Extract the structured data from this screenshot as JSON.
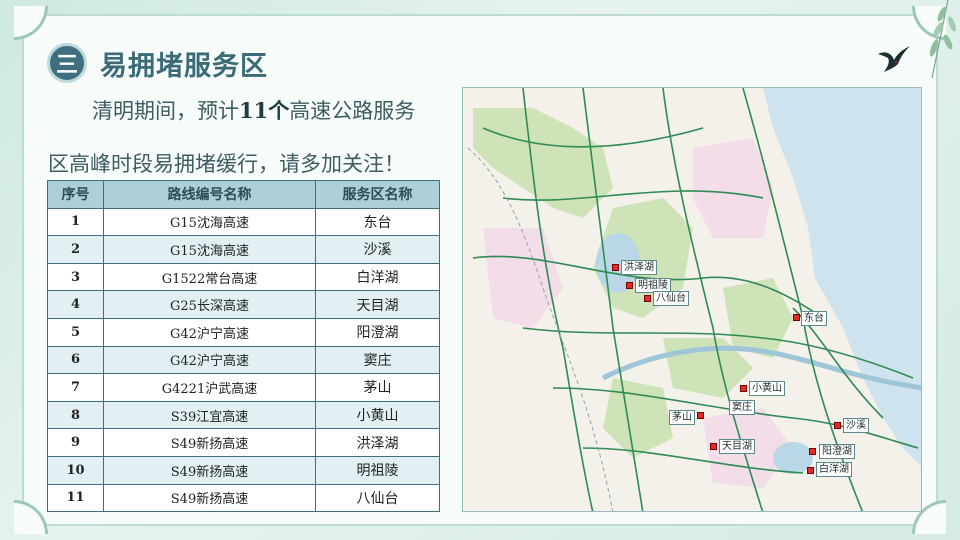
{
  "header": {
    "badge": "三",
    "title": "易拥堵服务区"
  },
  "intro": {
    "line1_prefix": "清明期间，预计",
    "count": "11个",
    "line1_suffix": "高速公路服务",
    "line2": "区高峰时段易拥堵缓行，请多加关注！"
  },
  "table": {
    "headers": [
      "序号",
      "路线编号名称",
      "服务区名称"
    ],
    "rows": [
      {
        "no": "1",
        "route": "G15沈海高速",
        "area": "东台"
      },
      {
        "no": "2",
        "route": "G15沈海高速",
        "area": "沙溪"
      },
      {
        "no": "3",
        "route": "G1522常台高速",
        "area": "白洋湖"
      },
      {
        "no": "4",
        "route": "G25长深高速",
        "area": "天目湖"
      },
      {
        "no": "5",
        "route": "G42沪宁高速",
        "area": "阳澄湖"
      },
      {
        "no": "6",
        "route": "G42沪宁高速",
        "area": "窦庄"
      },
      {
        "no": "7",
        "route": "G4221沪武高速",
        "area": "茅山"
      },
      {
        "no": "8",
        "route": "S39江宜高速",
        "area": "小黄山"
      },
      {
        "no": "9",
        "route": "S49新扬高速",
        "area": "洪泽湖"
      },
      {
        "no": "10",
        "route": "S49新扬高速",
        "area": "明祖陵"
      },
      {
        "no": "11",
        "route": "S49新扬高速",
        "area": "八仙台"
      }
    ]
  },
  "map": {
    "labels": {
      "hongzehu": "洪泽湖",
      "mingzuling": "明祖陵",
      "baxiantai": "八仙台",
      "dongtai": "东台",
      "xiaohuangshan": "小黄山",
      "douzhuang": "窦庄",
      "maoshan": "茅山",
      "tianmuhu": "天目湖",
      "shaxi": "沙溪",
      "yangchenghu": "阳澄湖",
      "baiyanghu": "白洋湖"
    },
    "colors": {
      "sea": "#cfe3ee",
      "land": "#f3f1ea",
      "green_zone": "#cfe3b8",
      "pink_zone": "#f2dde8",
      "road": "#2f8a55",
      "marker": "#e02b2b"
    }
  }
}
